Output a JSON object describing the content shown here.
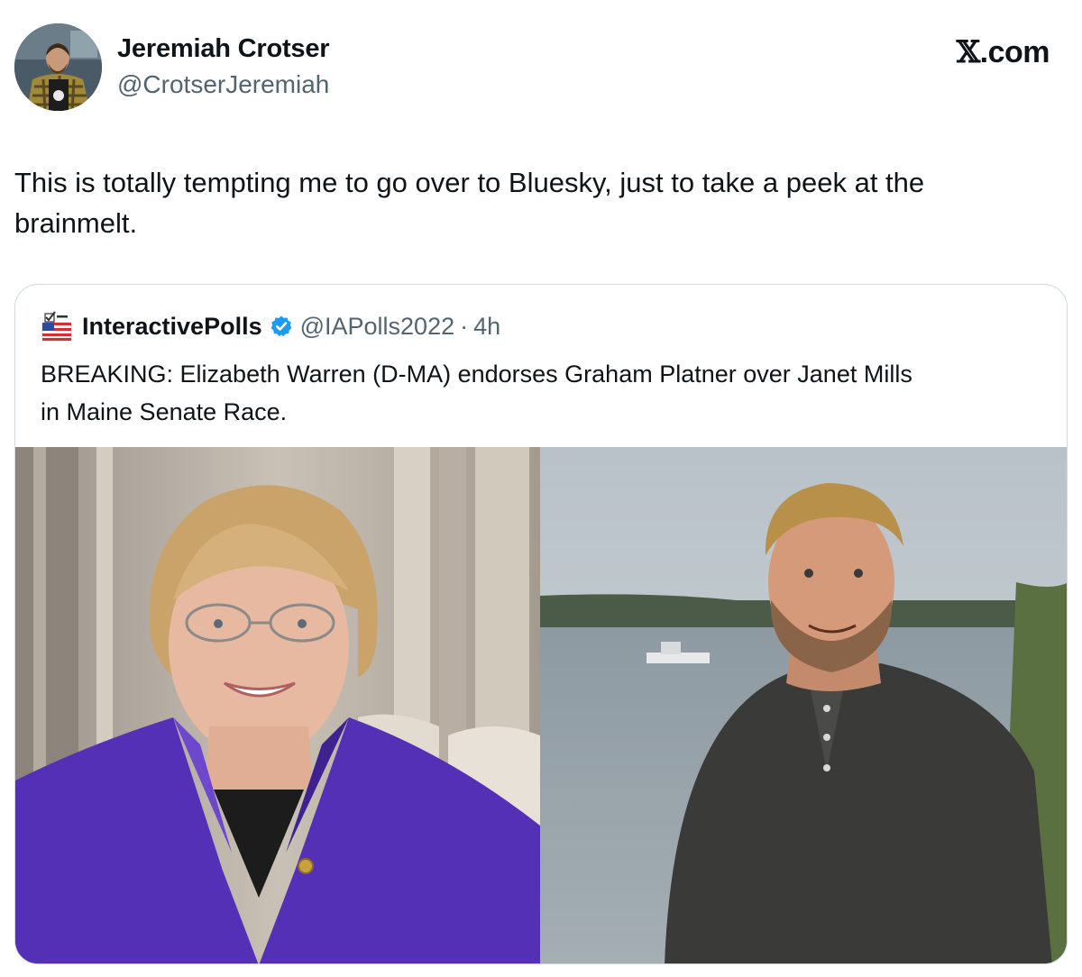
{
  "author": {
    "name": "Jeremiah Crotser",
    "handle": "@CrotserJeremiah"
  },
  "brand": {
    "label_x": "𝕏",
    "label_rest": ".com"
  },
  "tweet": {
    "text_line1": "This is totally tempting me to go over to Bluesky, just to take a peek at the",
    "text_line2": "brainmelt."
  },
  "quote": {
    "account_name": "InteractivePolls",
    "handle": "@IAPolls2022",
    "separator": "·",
    "time": "4h",
    "text_line1": "BREAKING: Elizabeth Warren (D-MA) endorses Graham Platner over Janet Mills",
    "text_line2": "in Maine Senate Race."
  },
  "colors": {
    "text_primary": "#0f1419",
    "text_secondary": "#536471",
    "verified_blue": "#1d9bf0",
    "card_border": "#cfd9de",
    "jacket_purple": "#5430b6"
  },
  "icons": [
    "us-flag-ballot-icon",
    "verified-badge-icon",
    "x-logo"
  ]
}
